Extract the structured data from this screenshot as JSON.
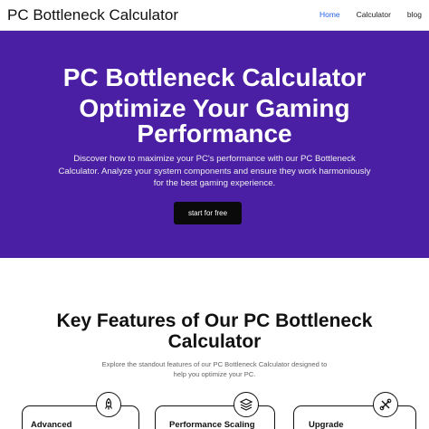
{
  "header": {
    "brand": "PC Bottleneck Calculator",
    "nav": [
      {
        "label": "Home",
        "active": true
      },
      {
        "label": "Calculator",
        "active": false
      },
      {
        "label": "blog",
        "active": false
      }
    ]
  },
  "hero": {
    "title": "PC Bottleneck Calculator",
    "subtitle": "Optimize Your Gaming Performance",
    "description": "Discover how to maximize your PC's performance with our PC Bottleneck Calculator. Analyze your system components and ensure they work harmoniously for the best gaming experience.",
    "cta_label": "start for free",
    "background_color": "#4a1fa3"
  },
  "features": {
    "title": "Key Features of Our PC Bottleneck Calculator",
    "description": "Explore the standout features of our PC Bottleneck Calculator designed to help you optimize your PC.",
    "cards": [
      {
        "label": "Advanced",
        "icon": "rocket-icon"
      },
      {
        "label": "Performance Scaling",
        "icon": "layers-icon"
      },
      {
        "label": "Upgrade",
        "icon": "tools-icon"
      }
    ]
  }
}
